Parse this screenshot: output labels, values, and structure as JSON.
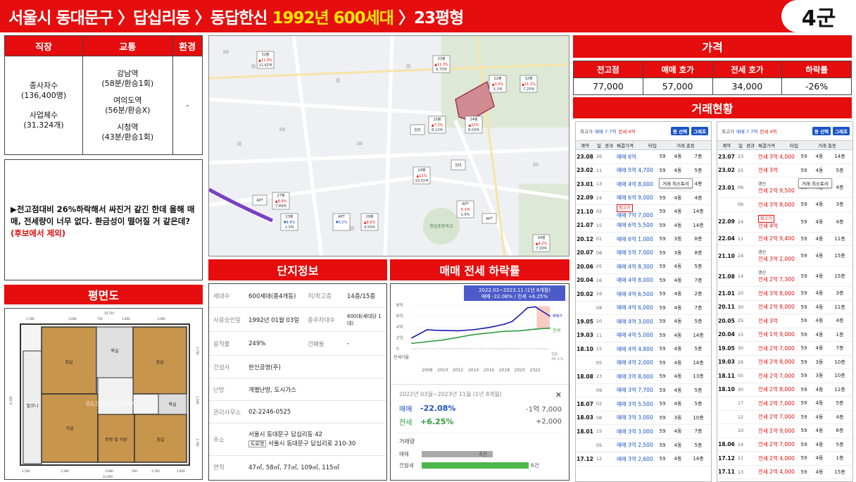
{
  "header": {
    "title_part1": "서울시 동대문구 〉답십리동 〉동답한신",
    "title_highlight": "1992년 600세대",
    "title_part2": "〉23평형",
    "group": "4군"
  },
  "info_table": {
    "headers": [
      "직장",
      "교통",
      "환경"
    ],
    "job": {
      "line1": "종사자수",
      "line2": "(136,400명)",
      "line3": "사업체수",
      "line4": "(31,324개)"
    },
    "transit": [
      {
        "station": "강남역",
        "time": "(58분/환승1회)"
      },
      {
        "station": "여의도역",
        "time": "(56분/환승X)"
      },
      {
        "station": "시청역",
        "time": "(43분/환승1회)"
      }
    ],
    "environment": "-"
  },
  "comment": {
    "text": "▶전고점대비 26%하락해서  싸진거 같긴 한데 올해 매매, 전세량이 너무 없다. 환금성이 떨어질 거 같은데?",
    "note": "(후보에서  제외)"
  },
  "floor_plan": {
    "title": "평면도",
    "dims_top_total": "10,750",
    "dims_top": [
      "1,500",
      "3,600",
      "750",
      "1,850",
      "3,000"
    ],
    "dims_bottom": [
      "1,500",
      "3,300",
      "3,000",
      "500",
      "2,700",
      "1,850"
    ],
    "dims_bottom_total": "12,000",
    "dims_left": "6,300",
    "dims_right_top": "2,700",
    "dims_right_mid": "1,500",
    "dims_right_bot": "2,700",
    "rooms": [
      "침실",
      "침실",
      "거실",
      "주방 및 식당",
      "침실",
      "발코니",
      "욕실",
      "욕실"
    ],
    "watermark": "B&S PLATFORM"
  },
  "map": {
    "markers": [
      {
        "label": "32평",
        "price": "▲11.9%",
        "sub": "12.42억"
      },
      {
        "label": "33평",
        "price": "▲11.3%",
        "sub": "6.75억"
      },
      {
        "label": "22평",
        "price": "▲3.5%",
        "sub": "5.1억"
      },
      {
        "label": "32평",
        "price": "▲11.2%",
        "sub": "7.25억"
      },
      {
        "label": "25평",
        "price": "▲7.2%",
        "sub": "8.12억"
      },
      {
        "label": "24평",
        "price": "▲12%",
        "sub": "8.03억"
      },
      {
        "label": "임대",
        "price": "",
        "sub": ""
      },
      {
        "label": "24평",
        "price": "▲11%",
        "sub": "10.01억"
      },
      {
        "label": "임대",
        "price": "",
        "sub": ""
      },
      {
        "label": "APT",
        "price": "",
        "sub": ""
      },
      {
        "label": "27평",
        "price": "▲8.9%",
        "sub": "7.89억"
      },
      {
        "label": "23평",
        "price": "▼4.8%",
        "sub": "1.3억"
      },
      {
        "label": "APT",
        "price": "▼6.2%",
        "sub": "1.04억"
      },
      {
        "label": "29평",
        "price": "▲8.6%",
        "sub": "9.55억"
      },
      {
        "label": "APT",
        "price": "5.1억",
        "sub": "2.9%"
      },
      {
        "label": "APT",
        "price": "",
        "sub": ""
      },
      {
        "label": "34평",
        "price": "▲4.2%",
        "sub": "7.29억"
      }
    ],
    "place_label": "동답초등학교"
  },
  "complex": {
    "title": "단지정보",
    "rows": [
      {
        "k1": "세대수",
        "v1": "600세대(총4개동)",
        "k2": "저/최고층",
        "v2": "14층/15층"
      },
      {
        "k1": "사용승인일",
        "v1": "1992년 01월 03일",
        "k2": "총주차대수",
        "v2": "600대(세대당 1대)"
      },
      {
        "k1": "용적률",
        "v1": "249%",
        "k2": "건폐율",
        "v2": "-"
      },
      {
        "k1": "건설사",
        "v1": "한신공영(주)"
      },
      {
        "k1": "난방",
        "v1": "개별난방, 도시가스"
      },
      {
        "k1": "관리사무소",
        "v1": "02-2246-0525"
      },
      {
        "k1": "주소",
        "v1": "서울시 동대문구 답십리동 42",
        "v1b_tag": "도로명",
        "v1b": "서울시 동대문구 답십리로 210-30"
      },
      {
        "k1": "면적",
        "v1": "47㎡, 58㎡, 77㎡, 109㎡, 115㎡"
      }
    ]
  },
  "rate": {
    "title": "매매 전세 하락률",
    "chart_data": {
      "type": "line",
      "title": "2022.03~2023.11 (1년 8개월)",
      "subtitle": "매매 -22.08% / 전세 +6.25%",
      "x_ticks": [
        "2008",
        "2010",
        "2012",
        "2014",
        "2016",
        "2018",
        "2020",
        "2022"
      ],
      "y_ticks": [
        "8억",
        "6억",
        "4억",
        "2억",
        "0"
      ],
      "ylim": [
        0,
        8
      ],
      "series": [
        {
          "name": "매매가",
          "color": "#1a1ab4",
          "x": [
            2006,
            2008,
            2009,
            2012,
            2014,
            2016,
            2018,
            2019,
            2020,
            2021,
            2022,
            2023.9
          ],
          "values": [
            2.0,
            3.5,
            3.4,
            3.3,
            3.5,
            3.9,
            4.5,
            5.0,
            6.2,
            7.5,
            7.7,
            6.0
          ]
        },
        {
          "name": "전세",
          "color": "#2e9e3e",
          "x": [
            2006,
            2010,
            2014,
            2018,
            2020,
            2022,
            2023.9
          ],
          "values": [
            1.0,
            1.6,
            2.6,
            3.2,
            3.3,
            3.6,
            3.8
          ]
        },
        {
          "name": "갭",
          "color": "#999999",
          "x": [
            2006,
            2023.9
          ],
          "values": [
            0,
            0
          ]
        }
      ],
      "side_labels": {
        "sale": "매매가",
        "jeonse": "전세",
        "gap": "갭률",
        "gap_rate": "46.1%"
      },
      "footer_label": "전세가율"
    },
    "summary": {
      "period": "2022년 03월~2023년 11월 (1년 8개월)",
      "sale_label": "매매",
      "sale_rate": "-22.08%",
      "sale_amount": "-1억 7,000",
      "jeonse_label": "전세",
      "jeonse_rate": "+6.25%",
      "jeonse_amount": "+2,000",
      "volume_title": "거래량",
      "volume": [
        {
          "label": "매매",
          "count": "4건",
          "value": 4,
          "color": "#a9a9a9"
        },
        {
          "label": "전월세",
          "count": "6건",
          "value": 6,
          "color": "#4cb84c"
        }
      ],
      "close": "✕"
    }
  },
  "price": {
    "title": "가격",
    "headers": [
      "전고점",
      "매매 호가",
      "전세 호가",
      "하락률"
    ],
    "values": [
      "77,000",
      "57,000",
      "34,000",
      "-26%"
    ]
  },
  "trade": {
    "title": "거래현황",
    "panel_left": {
      "top": {
        "a": "최고가",
        "b": "매매 7.7억",
        "c": "전세 4억",
        "btn1": "동 선택",
        "btn2": "그래프"
      },
      "headers": [
        "계약",
        "일",
        "경과",
        "체결가격",
        "타입",
        "거래 층동"
      ],
      "tooltip": "거래 히스토리",
      "rows": [
        {
          "m": "23.08",
          "d": "26",
          "tag": "",
          "p": "매매 6억",
          "t": "59",
          "dong": "4동",
          "fl": "7층",
          "c": "m"
        },
        {
          "m": "23.02",
          "d": "11",
          "tag": "",
          "p": "매매 5억 4,700",
          "t": "59",
          "dong": "4동",
          "fl": "5층",
          "c": "m"
        },
        {
          "m": "23.01",
          "d": "13",
          "tag": "",
          "p": "매매 4억 8,000",
          "t": "59",
          "dong": "4동",
          "fl": "4층",
          "c": "m"
        },
        {
          "m": "22.09",
          "d": "24",
          "tag": "",
          "p": "매매 6억 9,000",
          "t": "59",
          "dong": "4동",
          "fl": "4층",
          "c": "m"
        },
        {
          "m": "21.10",
          "d": "02",
          "tag": "최고가",
          "p": "매매 7억 7,000",
          "t": "59",
          "dong": "4동",
          "fl": "14층",
          "c": "m"
        },
        {
          "m": "21.07",
          "d": "15",
          "tag": "",
          "p": "매매 6억 5,500",
          "t": "59",
          "dong": "4동",
          "fl": "14층",
          "c": "m"
        },
        {
          "m": "20.12",
          "d": "01",
          "tag": "",
          "p": "매매 6억 1,000",
          "t": "59",
          "dong": "3동",
          "fl": "8층",
          "c": "m"
        },
        {
          "m": "20.07",
          "d": "08",
          "tag": "",
          "p": "매매 5억 7,000",
          "t": "59",
          "dong": "3동",
          "fl": "8층",
          "c": "m"
        },
        {
          "m": "20.06",
          "d": "05",
          "tag": "",
          "p": "매매 4억 8,300",
          "t": "59",
          "dong": "4동",
          "fl": "5층",
          "c": "m"
        },
        {
          "m": "20.04",
          "d": "16",
          "tag": "",
          "p": "매매 4억 8,000",
          "t": "59",
          "dong": "4동",
          "fl": "7층",
          "c": "m"
        },
        {
          "m": "20.02",
          "d": "19",
          "tag": "",
          "p": "매매 4억 6,500",
          "t": "59",
          "dong": "4동",
          "fl": "2층",
          "c": "m"
        },
        {
          "m": "",
          "d": "08",
          "tag": "",
          "p": "매매 4억 6,000",
          "t": "59",
          "dong": "4동",
          "fl": "7층",
          "c": "m"
        },
        {
          "m": "19.05",
          "d": "10",
          "tag": "",
          "p": "매매 4억 3,000",
          "t": "59",
          "dong": "4동",
          "fl": "5층",
          "c": "m"
        },
        {
          "m": "19.03",
          "d": "11",
          "tag": "",
          "p": "매매 4억 5,000",
          "t": "59",
          "dong": "4동",
          "fl": "14층",
          "c": "m"
        },
        {
          "m": "18.10",
          "d": "15",
          "tag": "",
          "p": "매매 4억 4,800",
          "t": "59",
          "dong": "4동",
          "fl": "5층",
          "c": "m"
        },
        {
          "m": "",
          "d": "05",
          "tag": "",
          "p": "매매 4억 2,000",
          "t": "59",
          "dong": "4동",
          "fl": "14층",
          "c": "m"
        },
        {
          "m": "18.08",
          "d": "23",
          "tag": "",
          "p": "매매 3억 8,000",
          "t": "59",
          "dong": "4동",
          "fl": "13층",
          "c": "m"
        },
        {
          "m": "",
          "d": "09",
          "tag": "",
          "p": "매매 3억 7,700",
          "t": "59",
          "dong": "4동",
          "fl": "5층",
          "c": "m"
        },
        {
          "m": "18.07",
          "d": "02",
          "tag": "",
          "p": "매매 3억 5,500",
          "t": "59",
          "dong": "4동",
          "fl": "5층",
          "c": "m"
        },
        {
          "m": "18.03",
          "d": "08",
          "tag": "",
          "p": "매매 3억 3,000",
          "t": "59",
          "dong": "3동",
          "fl": "10층",
          "c": "m"
        },
        {
          "m": "18.01",
          "d": "15",
          "tag": "",
          "p": "매매 3억 3,000",
          "t": "59",
          "dong": "4동",
          "fl": "7층",
          "c": "m"
        },
        {
          "m": "",
          "d": "05",
          "tag": "",
          "p": "매매 3억 2,500",
          "t": "59",
          "dong": "4동",
          "fl": "5층",
          "c": "m"
        },
        {
          "m": "17.12",
          "d": "12",
          "tag": "",
          "p": "매매 3억 2,600",
          "t": "59",
          "dong": "4동",
          "fl": "14층",
          "c": "m"
        }
      ]
    },
    "panel_right": {
      "top": {
        "a": "최고가",
        "b": "매매 7.7억",
        "c": "전세 4억",
        "btn1": "동 선택",
        "btn2": "그래프"
      },
      "headers": [
        "계약",
        "일",
        "경과",
        "체결가격",
        "타입",
        "거래 층동"
      ],
      "tooltip": "거래 히스토리",
      "rows": [
        {
          "m": "23.07",
          "d": "23",
          "tag": "",
          "p": "전세 3억 4,000",
          "t": "59",
          "dong": "4동",
          "fl": "14층",
          "c": "j"
        },
        {
          "m": "23.02",
          "d": "25",
          "tag": "",
          "p": "전세 3억",
          "t": "59",
          "dong": "4동",
          "fl": "5층",
          "c": "j"
        },
        {
          "m": "23.01",
          "d": "06",
          "tag": "갱신",
          "p": "전세 2억 9,500",
          "t": "59",
          "dong": "4동",
          "fl": "4층",
          "c": "j",
          "tall": true
        },
        {
          "m": "",
          "d": "06",
          "tag": "",
          "p": "전세 3억 8,000",
          "t": "59",
          "dong": "4동",
          "fl": "3층",
          "c": "j"
        },
        {
          "m": "22.09",
          "d": "24",
          "tag": "최고가",
          "p": "전세 4억",
          "t": "59",
          "dong": "4동",
          "fl": "4층",
          "c": "j",
          "tall": true
        },
        {
          "m": "22.04",
          "d": "11",
          "tag": "",
          "p": "전세 2억 9,400",
          "t": "59",
          "dong": "4동",
          "fl": "11층",
          "c": "j"
        },
        {
          "m": "21.10",
          "d": "24",
          "tag": "갱신",
          "p": "전세 3억 2,000",
          "t": "59",
          "dong": "4동",
          "fl": "15층",
          "c": "j",
          "tall": true
        },
        {
          "m": "21.08",
          "d": "14",
          "tag": "갱신",
          "p": "전세 2억 7,300",
          "t": "59",
          "dong": "4동",
          "fl": "15층",
          "c": "j",
          "tall": true
        },
        {
          "m": "21.01",
          "d": "20",
          "tag": "",
          "p": "전세 3억 8,000",
          "t": "59",
          "dong": "4동",
          "fl": "3층",
          "c": "j"
        },
        {
          "m": "20.11",
          "d": "30",
          "tag": "",
          "p": "전세 2억 8,000",
          "t": "59",
          "dong": "4동",
          "fl": "11층",
          "c": "j"
        },
        {
          "m": "20.05",
          "d": "25",
          "tag": "",
          "p": "전세 3억",
          "t": "59",
          "dong": "4동",
          "fl": "4층",
          "c": "j"
        },
        {
          "m": "20.04",
          "d": "15",
          "tag": "",
          "p": "전세 1억 9,000",
          "t": "59",
          "dong": "4동",
          "fl": "1층",
          "c": "j"
        },
        {
          "m": "19.05",
          "d": "30",
          "tag": "",
          "p": "전세 2억 7,000",
          "t": "59",
          "dong": "4동",
          "fl": "7층",
          "c": "j"
        },
        {
          "m": "19.03",
          "d": "26",
          "tag": "",
          "p": "전세 2억 8,000",
          "t": "59",
          "dong": "3동",
          "fl": "10층",
          "c": "j"
        },
        {
          "m": "18.11",
          "d": "05",
          "tag": "",
          "p": "전세 2억 7,000",
          "t": "59",
          "dong": "3동",
          "fl": "10층",
          "c": "j"
        },
        {
          "m": "18.10",
          "d": "30",
          "tag": "",
          "p": "전세 2억 8,000",
          "t": "59",
          "dong": "4동",
          "fl": "11층",
          "c": "j"
        },
        {
          "m": "",
          "d": "17",
          "tag": "",
          "p": "전세 2억 7,000",
          "t": "59",
          "dong": "4동",
          "fl": "5층",
          "c": "j"
        },
        {
          "m": "",
          "d": "12",
          "tag": "",
          "p": "전세 2억 7,000",
          "t": "59",
          "dong": "4동",
          "fl": "4층",
          "c": "j"
        },
        {
          "m": "",
          "d": "10",
          "tag": "",
          "p": "전세 1억 9,000",
          "t": "59",
          "dong": "4동",
          "fl": "6층",
          "c": "j"
        },
        {
          "m": "18.06",
          "d": "14",
          "tag": "",
          "p": "전세 2억 7,000",
          "t": "59",
          "dong": "4동",
          "fl": "5층",
          "c": "j"
        },
        {
          "m": "17.12",
          "d": "21",
          "tag": "",
          "p": "전세 2억 4,000",
          "t": "59",
          "dong": "4동",
          "fl": "1층",
          "c": "j"
        },
        {
          "m": "17.11",
          "d": "13",
          "tag": "",
          "p": "전세 2억 4,000",
          "t": "59",
          "dong": "4동",
          "fl": "15층",
          "c": "j"
        }
      ]
    }
  }
}
